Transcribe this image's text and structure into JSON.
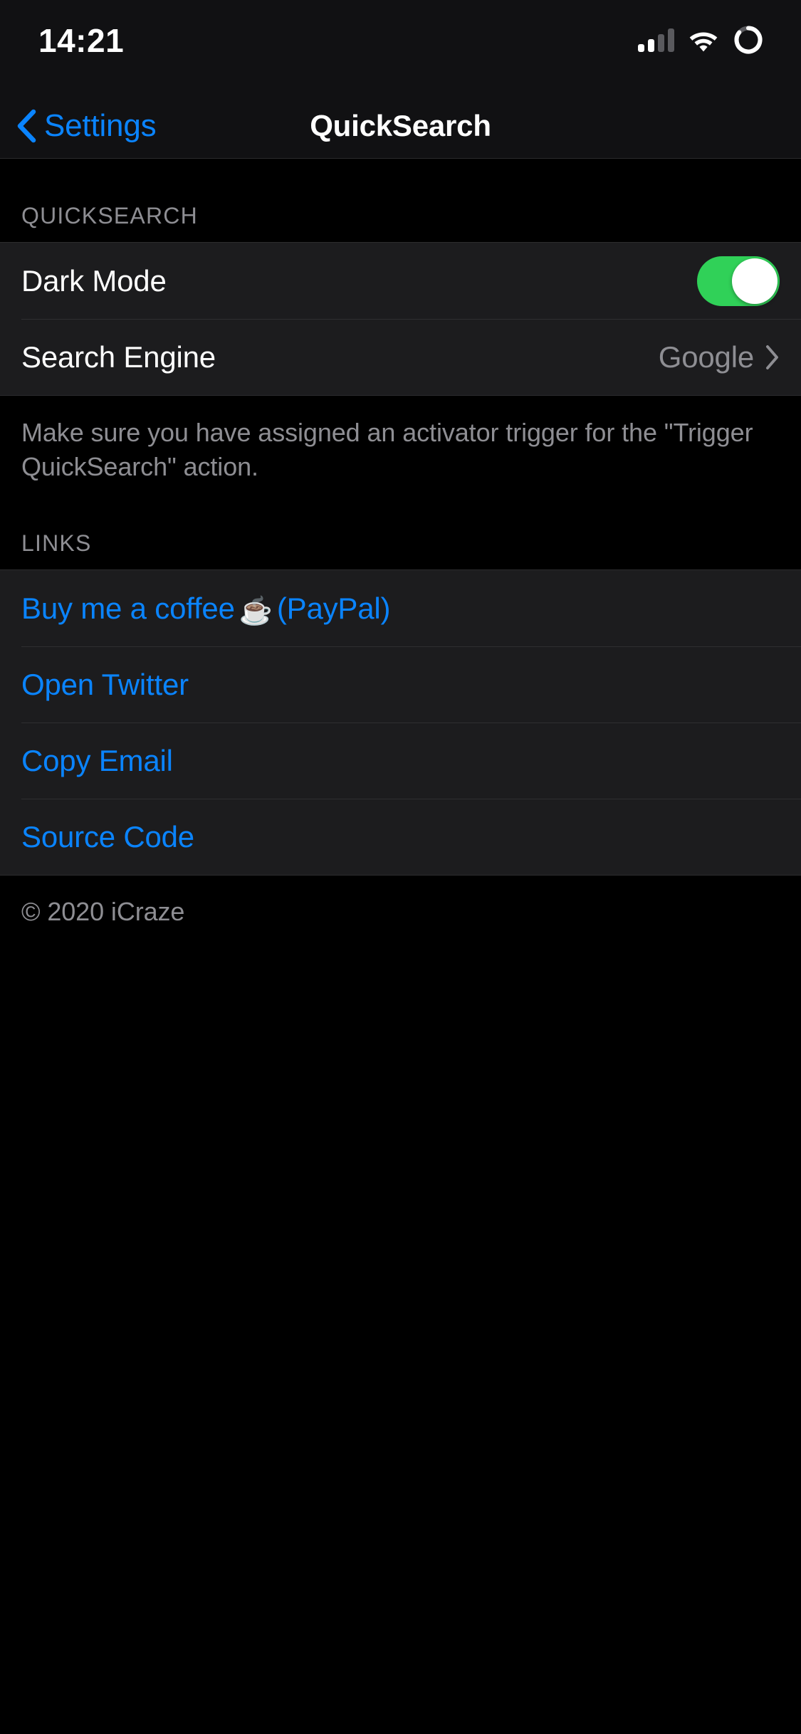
{
  "status_bar": {
    "time": "14:21",
    "cellular_icon": "cellular-signal-icon",
    "cellular_bars_filled": 2,
    "cellular_bars_total": 4,
    "wifi_icon": "wifi-icon",
    "battery_icon": "battery-ring-icon"
  },
  "nav": {
    "back_icon": "chevron-left-icon",
    "back_label": "Settings",
    "title": "QuickSearch"
  },
  "sections": {
    "quicksearch": {
      "header": "QUICKSEARCH",
      "rows": [
        {
          "title": "Dark Mode",
          "type": "toggle",
          "toggle_on": true
        },
        {
          "title": "Search Engine",
          "type": "disclosure",
          "value": "Google",
          "accessory_icon": "chevron-right-icon"
        }
      ],
      "footer": "Make sure you have assigned an activator trigger for the \"Trigger QuickSearch\" action."
    },
    "links": {
      "header": "LINKS",
      "rows": [
        {
          "title_before": "Buy me a coffee",
          "emoji": "☕",
          "title_after": "(PayPal)"
        },
        {
          "title": "Open Twitter"
        },
        {
          "title": "Copy Email"
        },
        {
          "title": "Source Code"
        }
      ]
    }
  },
  "copyright": "© 2020 iCraze",
  "colors": {
    "accent_blue": "#0a84ff",
    "toggle_green": "#30d158",
    "secondary_text": "#8e8e93",
    "cell_background": "#1c1c1e",
    "page_background": "#000000"
  }
}
